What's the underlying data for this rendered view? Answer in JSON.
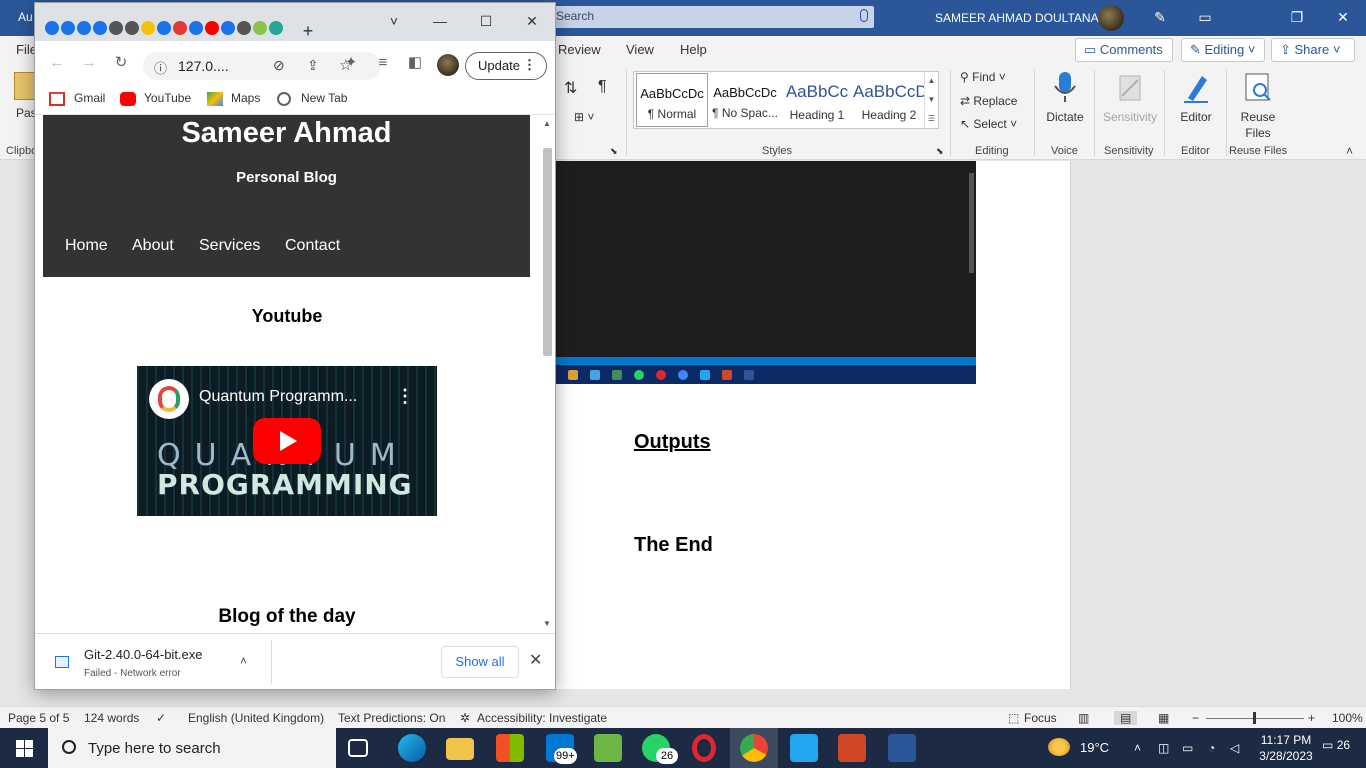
{
  "word": {
    "title_left": "Au",
    "search_placeholder": "Search",
    "user_name": "SAMEER AHMAD DOULTANA",
    "menu": {
      "file": "File",
      "review": "Review",
      "view": "View",
      "help": "Help",
      "comments": "Comments",
      "editing": "Editing",
      "share": "Share"
    },
    "ribbon": {
      "paste": "Past",
      "clipboard": "Clipbo",
      "styles_label": "Styles",
      "styles": [
        {
          "sample": "AaBbCcDc",
          "name": "¶ Normal"
        },
        {
          "sample": "AaBbCcDc",
          "name": "¶ No Spac..."
        },
        {
          "sample": "AaBbCc",
          "name": "Heading 1"
        },
        {
          "sample": "AaBbCcD",
          "name": "Heading 2"
        }
      ],
      "find": "Find",
      "replace": "Replace",
      "select": "Select",
      "editing_label": "Editing",
      "dictate": "Dictate",
      "voice_label": "Voice",
      "sensitivity": "Sensitivity",
      "sensitivity_label": "Sensitivity",
      "editor": "Editor",
      "editor_label": "Editor",
      "reuse": "Reuse",
      "files": "Files",
      "reuse_label": "Reuse Files"
    },
    "doc": {
      "outputs": "Outputs",
      "end": "The End"
    },
    "status": {
      "page": "Page 5 of 5",
      "words": "124 words",
      "language": "English (United Kingdom)",
      "predictions": "Text Predictions: On",
      "accessibility": "Accessibility: Investigate",
      "focus": "Focus",
      "zoom": "100%"
    }
  },
  "chrome": {
    "url": "127.0....",
    "update_label": "Update",
    "bookmarks": [
      "Gmail",
      "YouTube",
      "Maps",
      "New Tab"
    ],
    "site": {
      "title": "Sameer Ahmad",
      "subtitle": "Personal Blog",
      "nav": [
        "Home",
        "About",
        "Services",
        "Contact"
      ],
      "youtube_heading": "Youtube",
      "video_title": "Quantum Programm...",
      "video_overlay_1": "QUANTUM",
      "video_overlay_2": "PROGRAMMING",
      "blog_heading": "Blog of the day"
    },
    "download": {
      "file": "Git-2.40.0-64-bit.exe",
      "status": "Failed - Network error",
      "show_all": "Show all"
    }
  },
  "taskbar": {
    "search_placeholder": "Type here to search",
    "mail_badge": "99+",
    "whatsapp_badge": "26",
    "temperature": "19°C",
    "time": "11:17 PM",
    "date": "3/28/2023",
    "notifications": "26"
  },
  "colors": {
    "word_blue": "#2b579a",
    "site_header": "#333333",
    "youtube_red": "#ff0000",
    "chrome_link_blue": "#1a73e8"
  }
}
